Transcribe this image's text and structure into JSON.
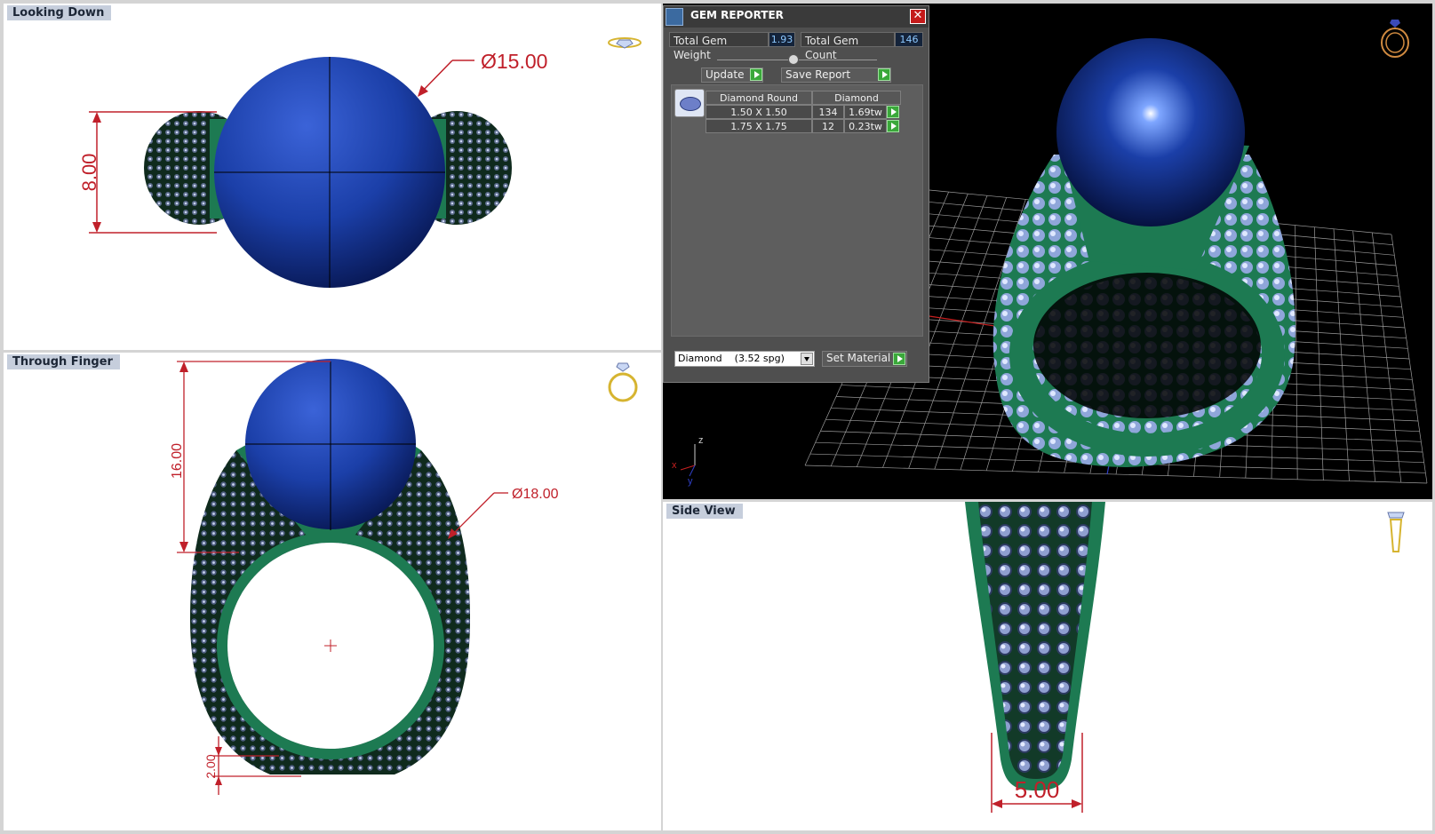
{
  "viewports": {
    "top_left": {
      "title": "Looking Down",
      "dim_diameter": "Ø15.00",
      "dim_height": "8.00"
    },
    "bottom_left": {
      "title": "Through Finger",
      "dim_height": "16.00",
      "dim_diameter": "Ø18.00",
      "dim_shank": "2.00"
    },
    "perspective": {
      "axis_x": "x",
      "axis_y": "y",
      "axis_z": "z"
    },
    "bottom_right": {
      "title": "Side View",
      "dim_width": "5.00"
    }
  },
  "gem_reporter": {
    "title": "GEM REPORTER",
    "close_symbol": "✕",
    "total_weight_label": "Total Gem Weight",
    "total_weight_value": "1.93",
    "total_count_label": "Total Gem Count",
    "total_count_value": "146",
    "update_label": "Update",
    "save_report_label": "Save Report",
    "table_header_cut": "Diamond Round",
    "table_header_material": "Diamond",
    "rows": [
      {
        "size": "1.50 X 1.50",
        "count": "134",
        "weight": "1.69tw"
      },
      {
        "size": "1.75 X 1.75",
        "count": "12",
        "weight": "0.23tw"
      }
    ],
    "material_select": "Diamond    (3.52 spg)",
    "set_material_label": "Set Material"
  },
  "colors": {
    "metal": "#1d7a52",
    "metal_dark": "#0f3d28",
    "pearl": "#1b3fa8",
    "dimension": "#c0202a",
    "panel": "#4f4f4f",
    "grid": "#9a9a9a",
    "gem": "#b7c6f2"
  },
  "icons": {
    "ring_top": "ring-top-view-icon",
    "ring_front": "ring-front-view-icon",
    "ring_perspective": "ring-perspective-icon",
    "ring_side": "ring-side-view-icon"
  }
}
